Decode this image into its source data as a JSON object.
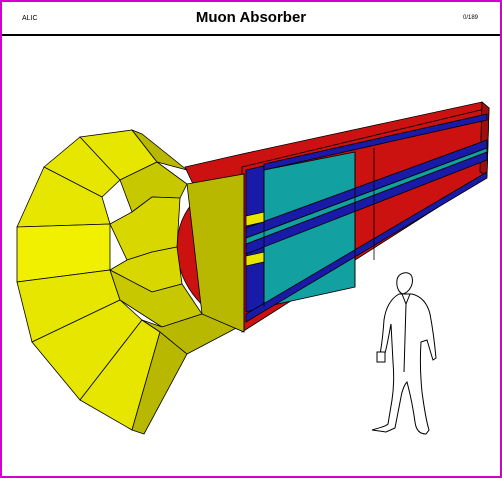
{
  "header": {
    "left_label": "ALIC",
    "title": "Muon Absorber",
    "right_label": "0/189"
  },
  "colors": {
    "frame": "#d000d0",
    "yellow": "#e6e600",
    "yellow_dark": "#b8b800",
    "red": "#cc1111",
    "red_dark": "#a00e0e",
    "blue": "#1a1aa8",
    "teal": "#12a0a0",
    "outline": "#000000"
  }
}
